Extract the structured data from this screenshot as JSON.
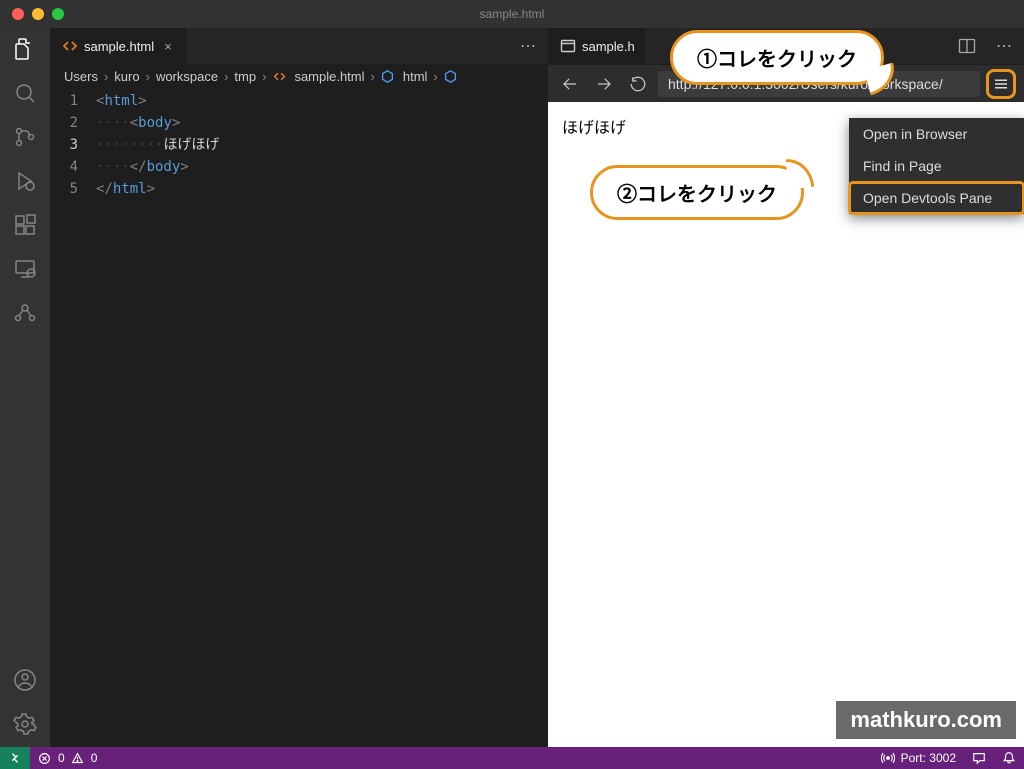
{
  "titlebar": {
    "title": "sample.html"
  },
  "tabs": {
    "editor": {
      "label": "sample.html",
      "icon": "<>"
    },
    "preview": {
      "label": "sample.h"
    }
  },
  "breadcrumbs": {
    "parts": [
      "Users",
      "kuro",
      "workspace",
      "tmp",
      "sample.html",
      "html"
    ]
  },
  "code": {
    "lines": [
      {
        "n": "1",
        "indent": "",
        "open": "html",
        "close": ""
      },
      {
        "n": "2",
        "indent": "····",
        "open": "body",
        "close": ""
      },
      {
        "n": "3",
        "indent": "········",
        "text": "ほげほげ"
      },
      {
        "n": "4",
        "indent": "····",
        "close_tag": "body"
      },
      {
        "n": "5",
        "indent": "",
        "close_tag": "html"
      }
    ],
    "current_line": "3"
  },
  "preview": {
    "url": "http://127.0.0.1:3002/Users/kuro/workspace/",
    "body_text": "ほげほげ",
    "menu": {
      "open_browser": "Open in Browser",
      "find_in_page": "Find in Page",
      "open_devtools": "Open Devtools Pane"
    }
  },
  "callouts": {
    "c1": "①コレをクリック",
    "c2": "②コレをクリック"
  },
  "statusbar": {
    "errors": "0",
    "warnings": "0",
    "port_label": "Port: 3002"
  },
  "watermark": "mathkuro.com"
}
